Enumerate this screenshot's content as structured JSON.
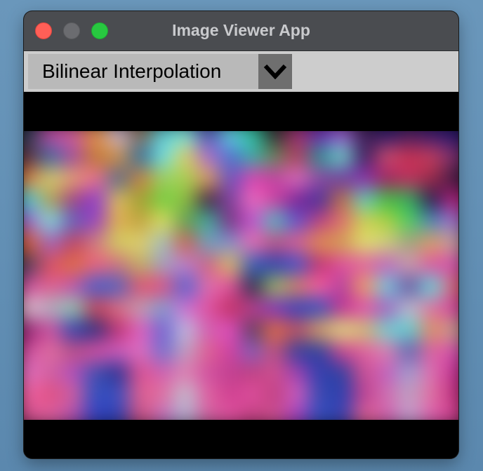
{
  "window": {
    "title": "Image Viewer App",
    "traffic_lights": {
      "close": "#ff5f57",
      "minimize": "#6b6c70",
      "maximize": "#28c840"
    }
  },
  "toolbar": {
    "interpolation_select": {
      "value": "Bilinear Interpolation",
      "arrow_icon": "chevron-down-icon"
    }
  },
  "image_palette": [
    "#2a3e55",
    "#c54aa6",
    "#d4609b",
    "#e79045",
    "#c6b7d8",
    "#8a6a50",
    "#5ccbd6",
    "#7be5dd",
    "#4f4fb0",
    "#62d3e4",
    "#33c7a4",
    "#2c2c2c",
    "#a03070",
    "#6a2bb0",
    "#9a5ad0",
    "#401f52",
    "#2b1a6b",
    "#4a2060",
    "#3a1b6e",
    "#26186e",
    "#5f3040",
    "#3b6aa6",
    "#a34aa0",
    "#c07a30",
    "#d19048",
    "#2f6fa0",
    "#70e0e8",
    "#e0d060",
    "#b06bd0",
    "#4f72d0",
    "#3ab0a8",
    "#6a8a5a",
    "#b43c5a",
    "#2a9090",
    "#70d7c8",
    "#3a1b60",
    "#d05070",
    "#c73050",
    "#c54060",
    "#7b3070",
    "#e08040",
    "#d6d070",
    "#e8a070",
    "#f07090",
    "#4f6a90",
    "#d08040",
    "#9fd060",
    "#a6d050",
    "#e0a060",
    "#6a50c0",
    "#e040b0",
    "#c040a0",
    "#dd70c0",
    "#904aa0",
    "#6a3aa0",
    "#9030b0",
    "#a02060",
    "#c03060",
    "#9b2a48",
    "#3a1a40",
    "#4ad0e0",
    "#b0a050",
    "#a04080",
    "#8a3ad0",
    "#e0c060",
    "#9fa030",
    "#70d040",
    "#90c040",
    "#402040",
    "#8040a0",
    "#f070c0",
    "#d040a0",
    "#7a2090",
    "#4030a0",
    "#c07040",
    "#60d0c0",
    "#40c040",
    "#30b060",
    "#2a1a50",
    "#c02080",
    "#a060d0",
    "#80e0e0",
    "#6060c0",
    "#9a40c0",
    "#e0b050",
    "#c0a040",
    "#e0e060",
    "#60a050",
    "#40b0a0",
    "#7a3080",
    "#c050d0",
    "#50c0c0",
    "#6050d0",
    "#c04080",
    "#e07070",
    "#d0d050",
    "#b0d040",
    "#50d060",
    "#4a8ac0",
    "#a070d0",
    "#e06030",
    "#a060c0",
    "#c04060",
    "#d08080",
    "#d0d060",
    "#e0d070",
    "#a0c0c0",
    "#d06050",
    "#70a0c0",
    "#8090d0",
    "#f070b0",
    "#c05080",
    "#e06090",
    "#e09050",
    "#d0a050",
    "#e0e070",
    "#d0d080",
    "#a0a080",
    "#e0a060",
    "#c0a0a0",
    "#4a4060",
    "#e05060",
    "#e07040",
    "#f06080",
    "#d07080",
    "#c0b060",
    "#a0a0c0",
    "#c080d0",
    "#d06080",
    "#e0c060",
    "#3060c0",
    "#2a40b0",
    "#4050d0",
    "#c03070",
    "#e050a0",
    "#e060a0",
    "#c060c0",
    "#d0a0b0",
    "#e050a0",
    "#d050b0",
    "#d050a0",
    "#e06090",
    "#c050b0",
    "#4060d0",
    "#5060c0",
    "#e05070",
    "#e05080",
    "#5060d0",
    "#e070b0",
    "#e050a0",
    "#2a2a4a",
    "#a0c060",
    "#e08060",
    "#ff60a0",
    "#b040a0",
    "#f0a060",
    "#70d0e0",
    "#6050a0",
    "#60e0e0",
    "#e06070",
    "#e0c0d0",
    "#b0b0c0",
    "#90d0b0",
    "#d04050",
    "#e07080",
    "#c0a0b0",
    "#80a0d0",
    "#d070d0",
    "#e050a0",
    "#c03060",
    "#c04090",
    "#8030c0",
    "#3040c0",
    "#3050c0",
    "#c03090",
    "#e050b0",
    "#a060c0",
    "#c0c0d0",
    "#e070a0",
    "#d040a0",
    "#902070",
    "#d050a0",
    "#3040b0",
    "#2a3080",
    "#c03070",
    "#e060c0",
    "#7060d0",
    "#c0c0e0",
    "#d060b0",
    "#e050c0",
    "#5a3a60",
    "#e07040",
    "#c05060",
    "#e0a060",
    "#e0e080",
    "#d0c070",
    "#70d0d0",
    "#60d0d0",
    "#e09060",
    "#c0a090",
    "#d050a0",
    "#e070a0",
    "#c05080",
    "#e050a0",
    "#d060c0",
    "#e070c0",
    "#7070d0",
    "#c0a0c0",
    "#e06090",
    "#d040a0",
    "#8060c0",
    "#c05080",
    "#3040a0",
    "#2a40a0",
    "#d04090",
    "#e060a0",
    "#e080b0",
    "#6060b0",
    "#e060a0",
    "#d050b0",
    "#e070c0",
    "#d060a0",
    "#b050c0",
    "#4050b0",
    "#2a3090",
    "#e05090",
    "#d060b0",
    "#e080b0",
    "#d050a0",
    "#c04090",
    "#c04080",
    "#d05090",
    "#a040b0",
    "#3040b0",
    "#3040a0",
    "#d05090",
    "#c060c0",
    "#a0a0d0",
    "#e070b0",
    "#c03090",
    "#f060a0",
    "#e05080",
    "#d060a0",
    "#3050c0",
    "#4050c0",
    "#e06090",
    "#e070a0",
    "#c0c0d0",
    "#e060a0",
    "#d04090",
    "#e050a0",
    "#c04080",
    "#d060c0",
    "#3a4ab0",
    "#2a40b0",
    "#c04090",
    "#d070b0",
    "#c0a0c0",
    "#e070a0",
    "#c03080",
    "#d05090",
    "#e060a0",
    "#b050b0",
    "#3040c0",
    "#3040b0",
    "#d05080",
    "#c070c0",
    "#b0b0d0",
    "#d060a0",
    "#e050a0",
    "#c04080",
    "#d05090",
    "#a040c0",
    "#3050c0",
    "#3a40b0",
    "#e06090",
    "#d060b0",
    "#c0a0d0",
    "#e060b0",
    "#d04090"
  ]
}
